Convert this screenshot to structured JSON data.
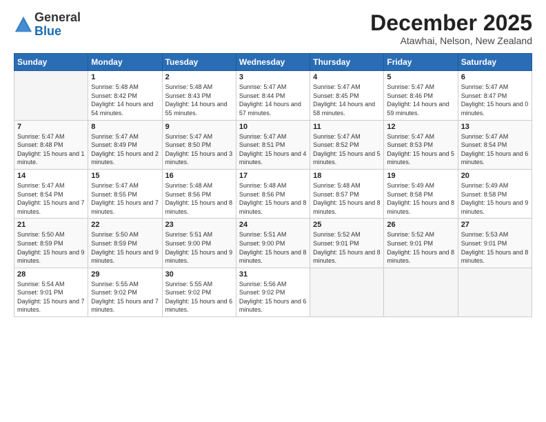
{
  "header": {
    "logo_general": "General",
    "logo_blue": "Blue",
    "month_title": "December 2025",
    "location": "Atawhai, Nelson, New Zealand"
  },
  "days_of_week": [
    "Sunday",
    "Monday",
    "Tuesday",
    "Wednesday",
    "Thursday",
    "Friday",
    "Saturday"
  ],
  "weeks": [
    [
      {
        "day": "",
        "sunrise": "",
        "sunset": "",
        "daylight": ""
      },
      {
        "day": "1",
        "sunrise": "Sunrise: 5:48 AM",
        "sunset": "Sunset: 8:42 PM",
        "daylight": "Daylight: 14 hours and 54 minutes."
      },
      {
        "day": "2",
        "sunrise": "Sunrise: 5:48 AM",
        "sunset": "Sunset: 8:43 PM",
        "daylight": "Daylight: 14 hours and 55 minutes."
      },
      {
        "day": "3",
        "sunrise": "Sunrise: 5:47 AM",
        "sunset": "Sunset: 8:44 PM",
        "daylight": "Daylight: 14 hours and 57 minutes."
      },
      {
        "day": "4",
        "sunrise": "Sunrise: 5:47 AM",
        "sunset": "Sunset: 8:45 PM",
        "daylight": "Daylight: 14 hours and 58 minutes."
      },
      {
        "day": "5",
        "sunrise": "Sunrise: 5:47 AM",
        "sunset": "Sunset: 8:46 PM",
        "daylight": "Daylight: 14 hours and 59 minutes."
      },
      {
        "day": "6",
        "sunrise": "Sunrise: 5:47 AM",
        "sunset": "Sunset: 8:47 PM",
        "daylight": "Daylight: 15 hours and 0 minutes."
      }
    ],
    [
      {
        "day": "7",
        "sunrise": "Sunrise: 5:47 AM",
        "sunset": "Sunset: 8:48 PM",
        "daylight": "Daylight: 15 hours and 1 minute."
      },
      {
        "day": "8",
        "sunrise": "Sunrise: 5:47 AM",
        "sunset": "Sunset: 8:49 PM",
        "daylight": "Daylight: 15 hours and 2 minutes."
      },
      {
        "day": "9",
        "sunrise": "Sunrise: 5:47 AM",
        "sunset": "Sunset: 8:50 PM",
        "daylight": "Daylight: 15 hours and 3 minutes."
      },
      {
        "day": "10",
        "sunrise": "Sunrise: 5:47 AM",
        "sunset": "Sunset: 8:51 PM",
        "daylight": "Daylight: 15 hours and 4 minutes."
      },
      {
        "day": "11",
        "sunrise": "Sunrise: 5:47 AM",
        "sunset": "Sunset: 8:52 PM",
        "daylight": "Daylight: 15 hours and 5 minutes."
      },
      {
        "day": "12",
        "sunrise": "Sunrise: 5:47 AM",
        "sunset": "Sunset: 8:53 PM",
        "daylight": "Daylight: 15 hours and 5 minutes."
      },
      {
        "day": "13",
        "sunrise": "Sunrise: 5:47 AM",
        "sunset": "Sunset: 8:54 PM",
        "daylight": "Daylight: 15 hours and 6 minutes."
      }
    ],
    [
      {
        "day": "14",
        "sunrise": "Sunrise: 5:47 AM",
        "sunset": "Sunset: 8:54 PM",
        "daylight": "Daylight: 15 hours and 7 minutes."
      },
      {
        "day": "15",
        "sunrise": "Sunrise: 5:47 AM",
        "sunset": "Sunset: 8:55 PM",
        "daylight": "Daylight: 15 hours and 7 minutes."
      },
      {
        "day": "16",
        "sunrise": "Sunrise: 5:48 AM",
        "sunset": "Sunset: 8:56 PM",
        "daylight": "Daylight: 15 hours and 8 minutes."
      },
      {
        "day": "17",
        "sunrise": "Sunrise: 5:48 AM",
        "sunset": "Sunset: 8:56 PM",
        "daylight": "Daylight: 15 hours and 8 minutes."
      },
      {
        "day": "18",
        "sunrise": "Sunrise: 5:48 AM",
        "sunset": "Sunset: 8:57 PM",
        "daylight": "Daylight: 15 hours and 8 minutes."
      },
      {
        "day": "19",
        "sunrise": "Sunrise: 5:49 AM",
        "sunset": "Sunset: 8:58 PM",
        "daylight": "Daylight: 15 hours and 8 minutes."
      },
      {
        "day": "20",
        "sunrise": "Sunrise: 5:49 AM",
        "sunset": "Sunset: 8:58 PM",
        "daylight": "Daylight: 15 hours and 9 minutes."
      }
    ],
    [
      {
        "day": "21",
        "sunrise": "Sunrise: 5:50 AM",
        "sunset": "Sunset: 8:59 PM",
        "daylight": "Daylight: 15 hours and 9 minutes."
      },
      {
        "day": "22",
        "sunrise": "Sunrise: 5:50 AM",
        "sunset": "Sunset: 8:59 PM",
        "daylight": "Daylight: 15 hours and 9 minutes."
      },
      {
        "day": "23",
        "sunrise": "Sunrise: 5:51 AM",
        "sunset": "Sunset: 9:00 PM",
        "daylight": "Daylight: 15 hours and 9 minutes."
      },
      {
        "day": "24",
        "sunrise": "Sunrise: 5:51 AM",
        "sunset": "Sunset: 9:00 PM",
        "daylight": "Daylight: 15 hours and 8 minutes."
      },
      {
        "day": "25",
        "sunrise": "Sunrise: 5:52 AM",
        "sunset": "Sunset: 9:01 PM",
        "daylight": "Daylight: 15 hours and 8 minutes."
      },
      {
        "day": "26",
        "sunrise": "Sunrise: 5:52 AM",
        "sunset": "Sunset: 9:01 PM",
        "daylight": "Daylight: 15 hours and 8 minutes."
      },
      {
        "day": "27",
        "sunrise": "Sunrise: 5:53 AM",
        "sunset": "Sunset: 9:01 PM",
        "daylight": "Daylight: 15 hours and 8 minutes."
      }
    ],
    [
      {
        "day": "28",
        "sunrise": "Sunrise: 5:54 AM",
        "sunset": "Sunset: 9:01 PM",
        "daylight": "Daylight: 15 hours and 7 minutes."
      },
      {
        "day": "29",
        "sunrise": "Sunrise: 5:55 AM",
        "sunset": "Sunset: 9:02 PM",
        "daylight": "Daylight: 15 hours and 7 minutes."
      },
      {
        "day": "30",
        "sunrise": "Sunrise: 5:55 AM",
        "sunset": "Sunset: 9:02 PM",
        "daylight": "Daylight: 15 hours and 6 minutes."
      },
      {
        "day": "31",
        "sunrise": "Sunrise: 5:56 AM",
        "sunset": "Sunset: 9:02 PM",
        "daylight": "Daylight: 15 hours and 6 minutes."
      },
      {
        "day": "",
        "sunrise": "",
        "sunset": "",
        "daylight": ""
      },
      {
        "day": "",
        "sunrise": "",
        "sunset": "",
        "daylight": ""
      },
      {
        "day": "",
        "sunrise": "",
        "sunset": "",
        "daylight": ""
      }
    ]
  ]
}
